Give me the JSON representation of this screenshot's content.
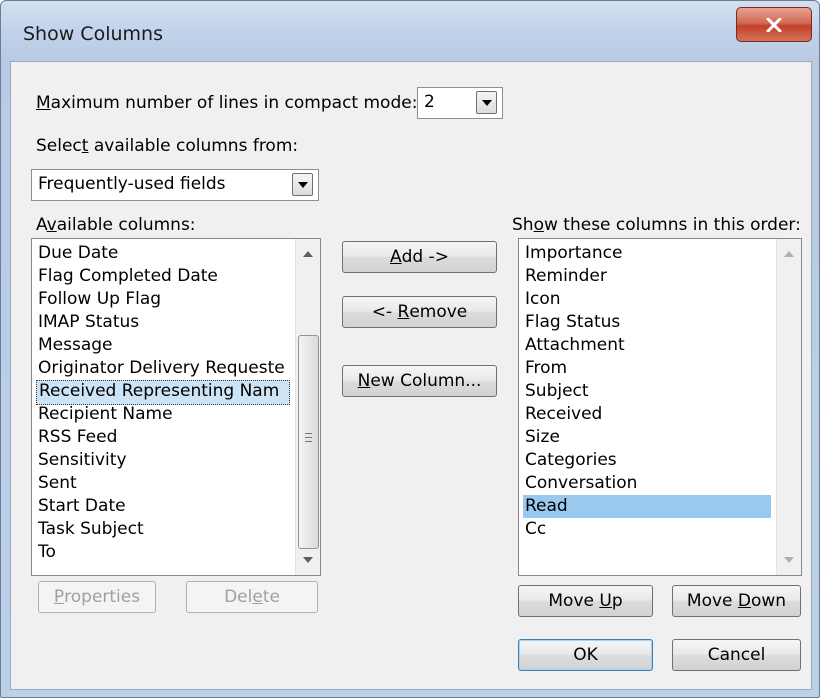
{
  "dialog": {
    "title": "Show Columns",
    "close_icon": "close-x-icon"
  },
  "compact_mode": {
    "label_pre": "",
    "label_u": "M",
    "label_post": "aximum number of lines in compact mode:",
    "value": "2"
  },
  "select_from": {
    "label_pre": "Selec",
    "label_u": "t",
    "label_post": " available columns from:",
    "value": "Frequently-used fields"
  },
  "available": {
    "label_pre": "A",
    "label_u": "v",
    "label_post": "ailable columns:",
    "items": [
      "Due Date",
      "Flag Completed Date",
      "Follow Up Flag",
      "IMAP Status",
      "Message",
      "Originator Delivery Requeste",
      "Received Representing Nam",
      "Recipient Name",
      "RSS Feed",
      "Sensitivity",
      "Sent",
      "Start Date",
      "Task Subject",
      "To"
    ],
    "selected": "Received Representing Nam"
  },
  "shown": {
    "label_pre": "Sh",
    "label_u": "o",
    "label_post": "w these columns in this order:",
    "items": [
      "Importance",
      "Reminder",
      "Icon",
      "Flag Status",
      "Attachment",
      "From",
      "Subject",
      "Received",
      "Size",
      "Categories",
      "Conversation",
      "Read",
      "Cc"
    ],
    "selected": "Read"
  },
  "buttons": {
    "add_u": "A",
    "add_rest": "dd ->",
    "remove_pre": "<- ",
    "remove_u": "R",
    "remove_rest": "emove",
    "new_u": "N",
    "new_rest": "ew Column...",
    "properties_u": "P",
    "properties_rest": "roperties",
    "delete_pre": "Del",
    "delete_u": "e",
    "delete_rest": "te",
    "move_up_pre": "Move ",
    "move_up_u": "U",
    "move_up_rest": "p",
    "move_down_pre": "Move ",
    "move_down_u": "D",
    "move_down_rest": "own",
    "ok": "OK",
    "cancel": "Cancel"
  }
}
